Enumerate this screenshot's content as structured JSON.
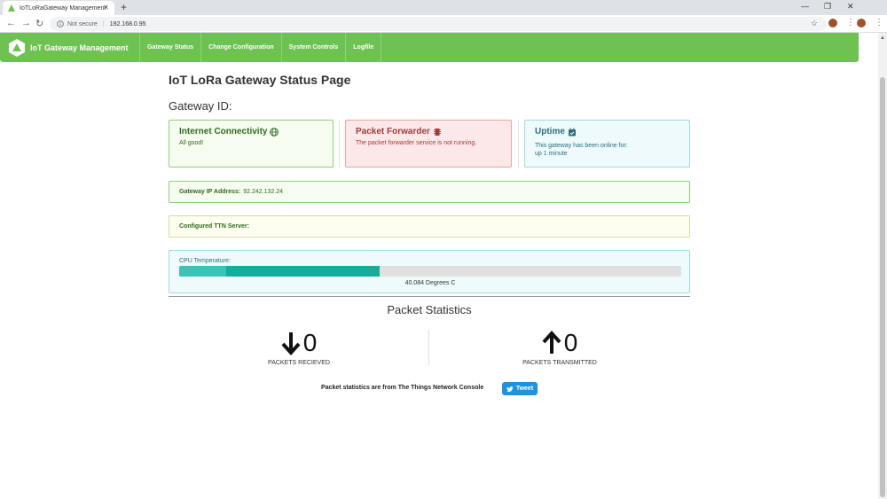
{
  "browser": {
    "tab_title": "IoTLoRaGateway Management",
    "new_tab_glyph": "+",
    "close_glyph": "✕",
    "security_label": "Not secure",
    "url": "192.168.0.95",
    "window_minimize": "—",
    "window_restore": "❐",
    "window_close": "✕"
  },
  "nav": {
    "brand": "IoT Gateway Management",
    "items": [
      "Gateway Status",
      "Change Configuration",
      "System Controls",
      "Logfile"
    ]
  },
  "page": {
    "title": "IoT LoRa Gateway Status Page",
    "gateway_id_label": "Gateway ID:"
  },
  "cards": {
    "internet": {
      "title": "Internet Connectivity",
      "text": "All good!"
    },
    "forwarder": {
      "title": "Packet Forwarder",
      "text": "The packet forwarder service is not running."
    },
    "uptime": {
      "title": "Uptime",
      "text": "This gateway has been online for:",
      "value": "up 1 minute"
    }
  },
  "gateway_ip": {
    "label": "Gateway IP Address:",
    "value": "92.242.132.24"
  },
  "ttn_server": {
    "label": "Configured TTN Server:"
  },
  "cpu": {
    "label": "CPU Temperature:",
    "reading": "40.084 Degrees C",
    "progress_percent": 40
  },
  "stats": {
    "title": "Packet Statistics",
    "received": {
      "value": "0",
      "caption": "PACKETS RECIEVED"
    },
    "transmitted": {
      "value": "0",
      "caption": "PACKETS TRANSMITTED"
    },
    "footer_text": "Packet statistics are from The Things Network Console",
    "tweet_label": "Tweet"
  },
  "colors": {
    "nav_green": "#6ec251",
    "progress_teal": "#14ad9c",
    "tweet_blue": "#1b95e0"
  }
}
